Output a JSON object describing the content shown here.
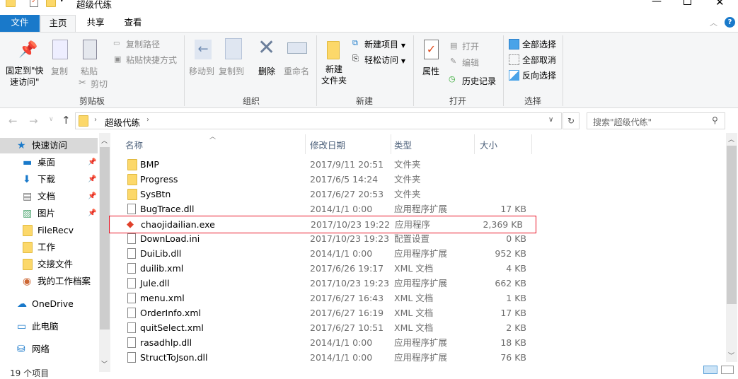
{
  "window": {
    "title": "超级代练",
    "controls": [
      "minimize",
      "maximize",
      "close"
    ]
  },
  "tabs": [
    {
      "label": "文件",
      "active": false
    },
    {
      "label": "主页",
      "active": true
    },
    {
      "label": "共享",
      "active": false
    },
    {
      "label": "查看",
      "active": false
    }
  ],
  "ribbon": {
    "clipboard": {
      "pin": "固定到\"快",
      "pin2": "速访问\"",
      "copy": "复制",
      "paste": "粘贴",
      "copy_path": "复制路径",
      "paste_shortcut": "粘贴快捷方式",
      "cut": "剪切",
      "group": "剪贴板"
    },
    "organize": {
      "move_to": "移动到",
      "copy_to": "复制到",
      "delete": "删除",
      "rename": "重命名",
      "group": "组织"
    },
    "new": {
      "new_folder": "新建",
      "new_folder2": "文件夹",
      "new_item": "新建项目",
      "easy_access": "轻松访问",
      "group": "新建"
    },
    "open": {
      "properties": "属性",
      "open": "打开",
      "edit": "编辑",
      "history": "历史记录",
      "group": "打开"
    },
    "select": {
      "select_all": "全部选择",
      "select_none": "全部取消",
      "invert": "反向选择",
      "group": "选择"
    }
  },
  "address": {
    "path": "超级代练",
    "search_placeholder": "搜索\"超级代练\""
  },
  "sidebar": [
    {
      "label": "快速访问",
      "icon": "star-icon",
      "pinned": false,
      "selected": true
    },
    {
      "label": "桌面",
      "icon": "desktop-icon",
      "pinned": true
    },
    {
      "label": "下载",
      "icon": "download-icon",
      "pinned": true
    },
    {
      "label": "文档",
      "icon": "document-icon",
      "pinned": true
    },
    {
      "label": "图片",
      "icon": "picture-icon",
      "pinned": true
    },
    {
      "label": "FileRecv",
      "icon": "folder-icon",
      "pinned": false
    },
    {
      "label": "工作",
      "icon": "folder-icon",
      "pinned": false
    },
    {
      "label": "交接文件",
      "icon": "folder-icon",
      "pinned": false
    },
    {
      "label": "我的工作档案",
      "icon": "globe-folder-icon",
      "pinned": false
    },
    {
      "label": "OneDrive",
      "icon": "cloud-icon",
      "pinned": false
    },
    {
      "label": "此电脑",
      "icon": "computer-icon",
      "pinned": false
    },
    {
      "label": "网络",
      "icon": "network-icon",
      "pinned": false
    }
  ],
  "columns": {
    "name": "名称",
    "date": "修改日期",
    "type": "类型",
    "size": "大小"
  },
  "files": [
    {
      "name": "BMP",
      "date": "2017/9/11 20:51",
      "type": "文件夹",
      "size": "",
      "kind": "folder"
    },
    {
      "name": "Progress",
      "date": "2017/6/5 14:24",
      "type": "文件夹",
      "size": "",
      "kind": "folder"
    },
    {
      "name": "SysBtn",
      "date": "2017/6/27 20:53",
      "type": "文件夹",
      "size": "",
      "kind": "folder"
    },
    {
      "name": "BugTrace.dll",
      "date": "2014/1/1 0:00",
      "type": "应用程序扩展",
      "size": "17 KB",
      "kind": "dll"
    },
    {
      "name": "chaojidailian.exe",
      "date": "2017/10/23 19:22",
      "type": "应用程序",
      "size": "2,369 KB",
      "kind": "exe",
      "highlighted": true
    },
    {
      "name": "DownLoad.ini",
      "date": "2017/10/23 19:23",
      "type": "配置设置",
      "size": "0 KB",
      "kind": "ini"
    },
    {
      "name": "DuiLib.dll",
      "date": "2014/1/1 0:00",
      "type": "应用程序扩展",
      "size": "952 KB",
      "kind": "dll"
    },
    {
      "name": "duilib.xml",
      "date": "2017/6/26 19:17",
      "type": "XML 文档",
      "size": "4 KB",
      "kind": "xml"
    },
    {
      "name": "Jule.dll",
      "date": "2017/10/23 19:23",
      "type": "应用程序扩展",
      "size": "662 KB",
      "kind": "dll"
    },
    {
      "name": "menu.xml",
      "date": "2017/6/27 16:43",
      "type": "XML 文档",
      "size": "1 KB",
      "kind": "xml"
    },
    {
      "name": "OrderInfo.xml",
      "date": "2017/6/27 16:19",
      "type": "XML 文档",
      "size": "17 KB",
      "kind": "xml"
    },
    {
      "name": "quitSelect.xml",
      "date": "2017/6/27 10:51",
      "type": "XML 文档",
      "size": "2 KB",
      "kind": "xml"
    },
    {
      "name": "rasadhlp.dll",
      "date": "2014/1/1 0:00",
      "type": "应用程序扩展",
      "size": "18 KB",
      "kind": "dll"
    },
    {
      "name": "StructToJson.dll",
      "date": "2014/1/1 0:00",
      "type": "应用程序扩展",
      "size": "76 KB",
      "kind": "dll"
    }
  ],
  "status": {
    "count": "19 个项目"
  },
  "colors": {
    "accent": "#1979ca",
    "highlight_border": "#e81123",
    "selected_bg": "#d9d9d9"
  }
}
